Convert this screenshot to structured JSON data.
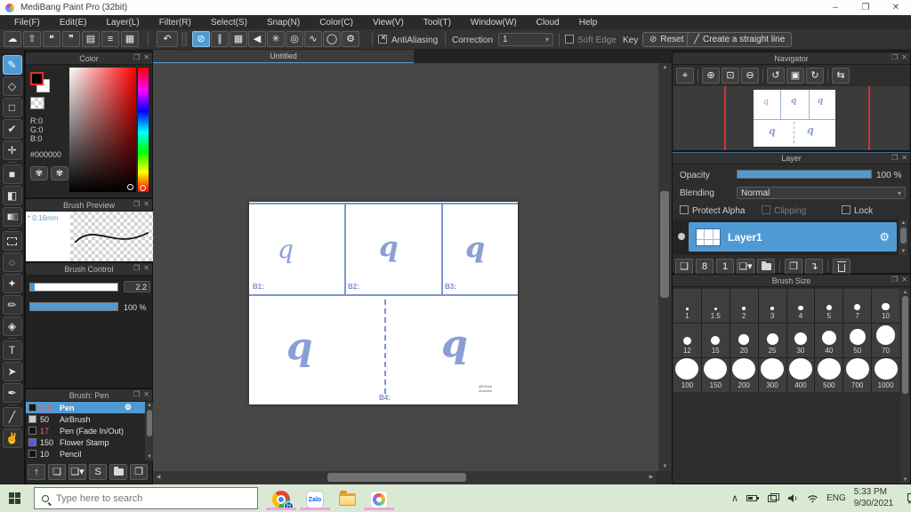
{
  "titlebar": {
    "title": "MediBang Paint Pro (32bit)"
  },
  "window_controls": {
    "minimize": "–",
    "maximize": "❐",
    "close": "✕"
  },
  "menubar": {
    "items": [
      "File(F)",
      "Edit(E)",
      "Layer(L)",
      "Filter(R)",
      "Select(S)",
      "Snap(N)",
      "Color(C)",
      "View(V)",
      "Tool(T)",
      "Window(W)",
      "Cloud",
      "Help"
    ]
  },
  "panel_chrome": {
    "popup_icon": "❐",
    "close_icon": "✕"
  },
  "toolbar": {
    "file_icons": [
      {
        "name": "cloud-icon",
        "glyph": "☁"
      },
      {
        "name": "share-icon",
        "glyph": "⇧"
      },
      {
        "name": "comment-icon",
        "glyph": "❝"
      },
      {
        "name": "message-icon",
        "glyph": "❞"
      },
      {
        "name": "document-icon",
        "glyph": "▤"
      },
      {
        "name": "material-list-icon",
        "glyph": "≡"
      },
      {
        "name": "grid-pen-icon",
        "glyph": "▦"
      }
    ],
    "undo_icon": "↶",
    "snap_icons": [
      {
        "name": "snap-off-icon",
        "glyph": "⊘",
        "selected": true
      },
      {
        "name": "snap-parallel-icon",
        "glyph": "∥"
      },
      {
        "name": "snap-grid-icon",
        "glyph": "▦"
      },
      {
        "name": "snap-vanishing-icon",
        "glyph": "◀"
      },
      {
        "name": "snap-radial-icon",
        "glyph": "✳"
      },
      {
        "name": "snap-concentric-icon",
        "glyph": "◎"
      },
      {
        "name": "snap-curve-icon",
        "glyph": "∿"
      },
      {
        "name": "snap-ellipse-icon",
        "glyph": "◯"
      },
      {
        "name": "snap-settings-icon",
        "glyph": "⚙"
      }
    ],
    "antialiasing_label": "AntiAliasing",
    "correction_label": "Correction",
    "correction_value": "1",
    "soft_edge_label": "Soft Edge",
    "key_label": "Key",
    "reset_icon": "⊘",
    "reset_label": "Reset",
    "straight_line_icon": "╱",
    "straight_line_label": "Create a straight line"
  },
  "left_toolbar": {
    "tools": [
      {
        "name": "brush-tool",
        "glyph": "✎",
        "selected": true
      },
      {
        "name": "eraser-tool",
        "glyph": "◇"
      },
      {
        "name": "rect-tool",
        "glyph": "□"
      },
      {
        "name": "dot-tool",
        "glyph": "✔"
      },
      {
        "name": "move-tool",
        "glyph": "✛",
        "sep_after": true
      },
      {
        "name": "fill-rect-tool",
        "glyph": "■"
      },
      {
        "name": "bucket-tool",
        "glyph": "◧"
      },
      {
        "name": "gradient-tool",
        "glyph": "css-gradient",
        "sep_after": true
      },
      {
        "name": "select-tool",
        "glyph": "css-dashedbox"
      },
      {
        "name": "lasso-tool",
        "glyph": "◌"
      },
      {
        "name": "magic-wand-tool",
        "glyph": "✦"
      },
      {
        "name": "select-pen-tool",
        "glyph": "✏"
      },
      {
        "name": "select-eraser-tool",
        "glyph": "◈",
        "sep_after": true
      },
      {
        "name": "text-tool",
        "glyph": "T"
      },
      {
        "name": "operation-tool",
        "glyph": "➤"
      },
      {
        "name": "brush-edit-tool",
        "glyph": "✒",
        "sep_after": true
      },
      {
        "name": "divide-tool",
        "glyph": "╱"
      },
      {
        "name": "hand-tool",
        "glyph": "✌"
      }
    ]
  },
  "color_panel": {
    "title": "Color",
    "r_label": "R:0",
    "g_label": "G:0",
    "b_label": "B:0",
    "hex": "#000000",
    "fg_color": "#000000",
    "bg_color": "#ffffff",
    "palette_icon": "✾",
    "palette_set_icon": "✾"
  },
  "brush_preview_panel": {
    "title": "Brush Preview",
    "size_label": "* 0.16mm"
  },
  "brush_control_panel": {
    "title": "Brush Control",
    "size_value": "2.2",
    "opacity_value": "100 %"
  },
  "brush_panel": {
    "title": "Brush: Pen",
    "gear_icon": "⚙",
    "brushes": [
      {
        "size": "2.2",
        "name": "Pen",
        "selected": true,
        "swatch": "#141414",
        "size_color": "#e06a6a"
      },
      {
        "size": "50",
        "name": "AirBrush",
        "swatch": "#cfcfcf",
        "size_color": "#e6e6e6"
      },
      {
        "size": "17",
        "name": "Pen (Fade In/Out)",
        "swatch": "#141414",
        "size_color": "#e06a6a"
      },
      {
        "size": "150",
        "name": "Flower Stamp",
        "swatch": "#4a5fe8",
        "size_color": "#e6e6e6"
      },
      {
        "size": "10",
        "name": "Pencil",
        "swatch": "#141414",
        "size_color": "#e6e6e6"
      }
    ],
    "footer_icons": [
      {
        "name": "cloud-upload-icon",
        "glyph": "↑"
      },
      {
        "name": "new-brush-icon",
        "glyph": "❏"
      },
      {
        "name": "add-brush-menu-icon",
        "glyph": "❏▾"
      },
      {
        "name": "script-brush-icon",
        "glyph": "S"
      },
      {
        "name": "folder-icon",
        "glyph": "css-folder"
      },
      {
        "name": "duplicate-brush-icon",
        "glyph": "❐"
      }
    ]
  },
  "canvas": {
    "tab_title": "Untitled",
    "letter": "q",
    "labels": {
      "b1": "B1:",
      "b2": "B2:",
      "b3": "B3:",
      "b4": "B4:"
    },
    "signature_line1": "@Ritche",
    "signature_line2": "#habqist"
  },
  "navigator_panel": {
    "title": "Navigator",
    "icons": [
      {
        "name": "zoom-actual-icon",
        "glyph": "⌖"
      },
      {
        "name": "zoom-in-icon",
        "glyph": "⊕",
        "group": true
      },
      {
        "name": "fit-screen-icon",
        "glyph": "⊡"
      },
      {
        "name": "zoom-out-icon",
        "glyph": "⊖"
      },
      {
        "name": "rotate-left-icon",
        "glyph": "↺",
        "group": true
      },
      {
        "name": "reset-rotation-icon",
        "glyph": "▣"
      },
      {
        "name": "rotate-right-icon",
        "glyph": "↻"
      },
      {
        "name": "flip-icon",
        "glyph": "⇆",
        "group": true
      }
    ]
  },
  "layer_panel": {
    "title": "Layer",
    "opacity_label": "Opacity",
    "opacity_value": "100 %",
    "blending_label": "Blending",
    "blending_value": "Normal",
    "protect_alpha_label": "Protect Alpha",
    "clipping_label": "Clipping",
    "lock_label": "Lock",
    "layer_name": "Layer1",
    "gear_icon": "⚙",
    "footer_icons": [
      {
        "name": "add-layer-icon",
        "glyph": "❏"
      },
      {
        "name": "add-8bit-layer-icon",
        "glyph": "8"
      },
      {
        "name": "add-1bit-layer-icon",
        "glyph": "1"
      },
      {
        "name": "add-layer-menu-icon",
        "glyph": "❏▾"
      },
      {
        "name": "folder-icon",
        "glyph": "css-folder"
      },
      {
        "name": "duplicate-layer-icon",
        "glyph": "❐",
        "group": true
      },
      {
        "name": "merge-layer-icon",
        "glyph": "↴"
      },
      {
        "name": "delete-layer-icon",
        "glyph": "css-trash",
        "group": true
      }
    ]
  },
  "brush_size_panel": {
    "title": "Brush Size",
    "sizes": [
      "1",
      "1.5",
      "2",
      "3",
      "4",
      "5",
      "7",
      "10",
      "12",
      "15",
      "20",
      "25",
      "30",
      "40",
      "50",
      "70",
      "100",
      "150",
      "200",
      "300",
      "400",
      "500",
      "700",
      "1000"
    ]
  },
  "taskbar": {
    "search_placeholder": "Type here to search",
    "zalo_label": "Zalo",
    "chrome_badge": "H",
    "language": "ENG",
    "time": "5:33 PM",
    "date": "9/30/2021"
  }
}
